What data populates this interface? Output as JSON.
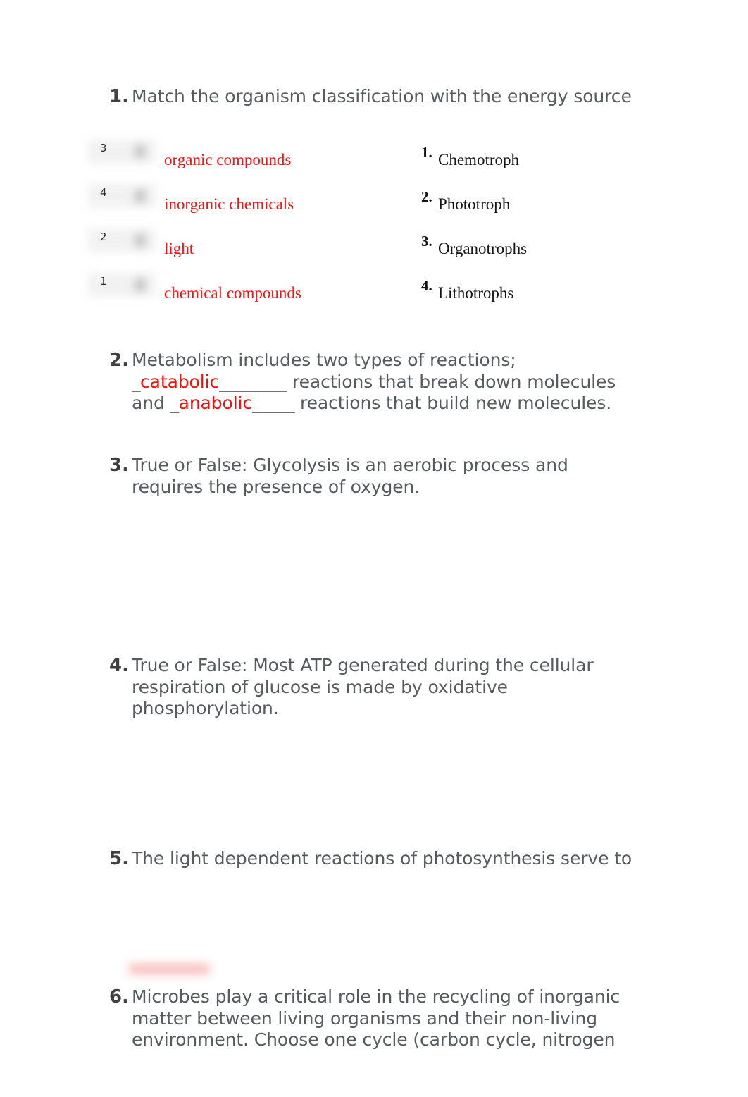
{
  "document": {
    "questions": [
      {
        "number": "1.",
        "lines": [
          "Match the organism classification with the energy source"
        ]
      },
      {
        "number": "2.",
        "segments": [
          {
            "type": "text",
            "value": "Metabolism includes two types of reactions;"
          },
          {
            "type": "blank_prefix",
            "value": "_"
          },
          {
            "type": "answer",
            "value": "catabolic"
          },
          {
            "type": "blank_suffix",
            "value": "________"
          },
          {
            "type": "text",
            "value": " reactions that break down molecules"
          },
          {
            "type": "text",
            "value": "and "
          },
          {
            "type": "blank_prefix",
            "value": "_"
          },
          {
            "type": "answer",
            "value": "anabolic"
          },
          {
            "type": "blank_suffix",
            "value": "_____"
          },
          {
            "type": "text",
            "value": " reactions that build new molecules."
          }
        ],
        "line1": "Metabolism includes two types of reactions;",
        "line2_blank_open": "_",
        "line2_answer": "catabolic",
        "line2_blank_close": "________",
        "line2_tail": " reactions that break down molecules",
        "line3_head": "and ",
        "line3_blank_open": "_",
        "line3_answer": "anabolic",
        "line3_blank_close": "_____",
        "line3_tail": " reactions that build new molecules."
      },
      {
        "number": "3.",
        "lines": [
          "True or False: Glycolysis is an aerobic process and",
          "requires the presence of oxygen."
        ]
      },
      {
        "number": "4.",
        "lines": [
          "True or False: Most ATP generated during the cellular",
          "respiration of glucose is made by oxidative",
          "phosphorylation."
        ]
      },
      {
        "number": "5.",
        "lines": [
          "The light dependent reactions of photosynthesis serve to"
        ]
      },
      {
        "number": "6.",
        "lines": [
          "Microbes play a critical role in the recycling of inorganic",
          "matter between living organisms and their non-living",
          "environment. Choose one cycle (carbon cycle, nitrogen"
        ]
      }
    ],
    "matching": {
      "rows": [
        {
          "answer_value": "3",
          "term": "organic compounds",
          "option_number": "1.",
          "option_label": "Chemotroph"
        },
        {
          "answer_value": "4",
          "term": "inorganic chemicals",
          "option_number": "2.",
          "option_label": "Phototroph"
        },
        {
          "answer_value": "2",
          "term": "light",
          "option_number": "3.",
          "option_label": "Organotrophs"
        },
        {
          "answer_value": "1",
          "term": "chemical compounds",
          "option_number": "4.",
          "option_label": "Lithotrophs"
        }
      ]
    },
    "colors": {
      "answer_red": "#ee1111",
      "term_red": "#f01414",
      "body_gray": "#555b5e",
      "number_gray": "#404040",
      "option_black": "#141414",
      "page_background": "#ffffff"
    }
  }
}
